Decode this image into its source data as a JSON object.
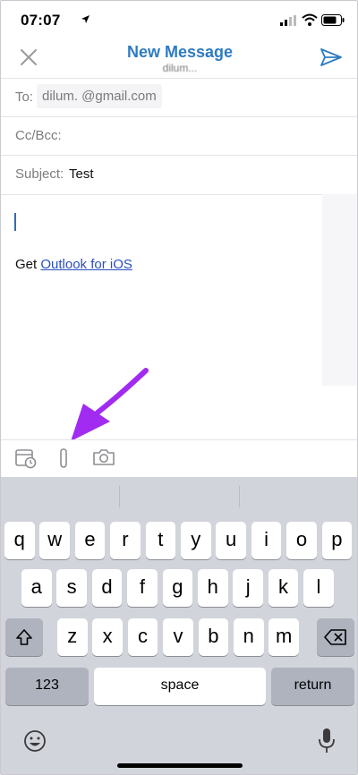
{
  "status_bar": {
    "time": "07:07"
  },
  "header": {
    "title": "New Message",
    "subtitle": "dilum...",
    "close_icon": "close-icon",
    "send_icon": "send-icon"
  },
  "form": {
    "to_label": "To:",
    "to_value": "dilum.       @gmail.com",
    "cc_label": "Cc/Bcc:",
    "subject_label": "Subject:",
    "subject_value": "Test"
  },
  "body": {
    "signature_prefix": "Get ",
    "signature_link": "Outlook for iOS"
  },
  "toolbar": {
    "icons": [
      "calendar-icon",
      "attachment-icon",
      "camera-icon"
    ],
    "annotation_color": "#a12bf0"
  },
  "keyboard": {
    "row1": [
      "q",
      "w",
      "e",
      "r",
      "t",
      "y",
      "u",
      "i",
      "o",
      "p"
    ],
    "row2": [
      "a",
      "s",
      "d",
      "f",
      "g",
      "h",
      "j",
      "k",
      "l"
    ],
    "row3": [
      "z",
      "x",
      "c",
      "v",
      "b",
      "n",
      "m"
    ],
    "numbers_label": "123",
    "space_label": "space",
    "return_label": "return"
  },
  "colors": {
    "accent": "#2f7bc0",
    "link": "#2a4fc0",
    "keyboard_bg": "#d2d4db"
  }
}
